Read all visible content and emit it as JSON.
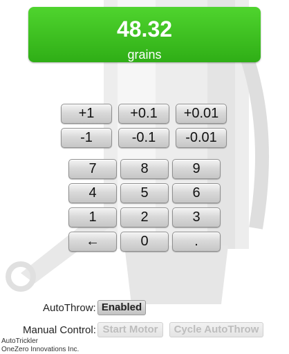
{
  "display": {
    "weight": "48.32",
    "unit": "grains"
  },
  "adjust_buttons": [
    {
      "label": "+1",
      "name": "plus-1-button"
    },
    {
      "label": "+0.1",
      "name": "plus-0-1-button"
    },
    {
      "label": "+0.01",
      "name": "plus-0-01-button"
    },
    {
      "label": "-1",
      "name": "minus-1-button"
    },
    {
      "label": "-0.1",
      "name": "minus-0-1-button"
    },
    {
      "label": "-0.01",
      "name": "minus-0-01-button"
    }
  ],
  "keypad": [
    "7",
    "8",
    "9",
    "4",
    "5",
    "6",
    "1",
    "2",
    "3",
    "←",
    "0",
    "."
  ],
  "autothrow": {
    "label": "AutoThrow:",
    "button": "Enabled"
  },
  "manual": {
    "label": "Manual Control:",
    "start": "Start Motor",
    "cycle": "Cycle AutoThrow"
  },
  "footer": {
    "line1": "AutoTrickler",
    "line2": "OneZero Innovations Inc."
  },
  "colors": {
    "display_green": "#3cc022",
    "display_text": "#ffffff"
  }
}
